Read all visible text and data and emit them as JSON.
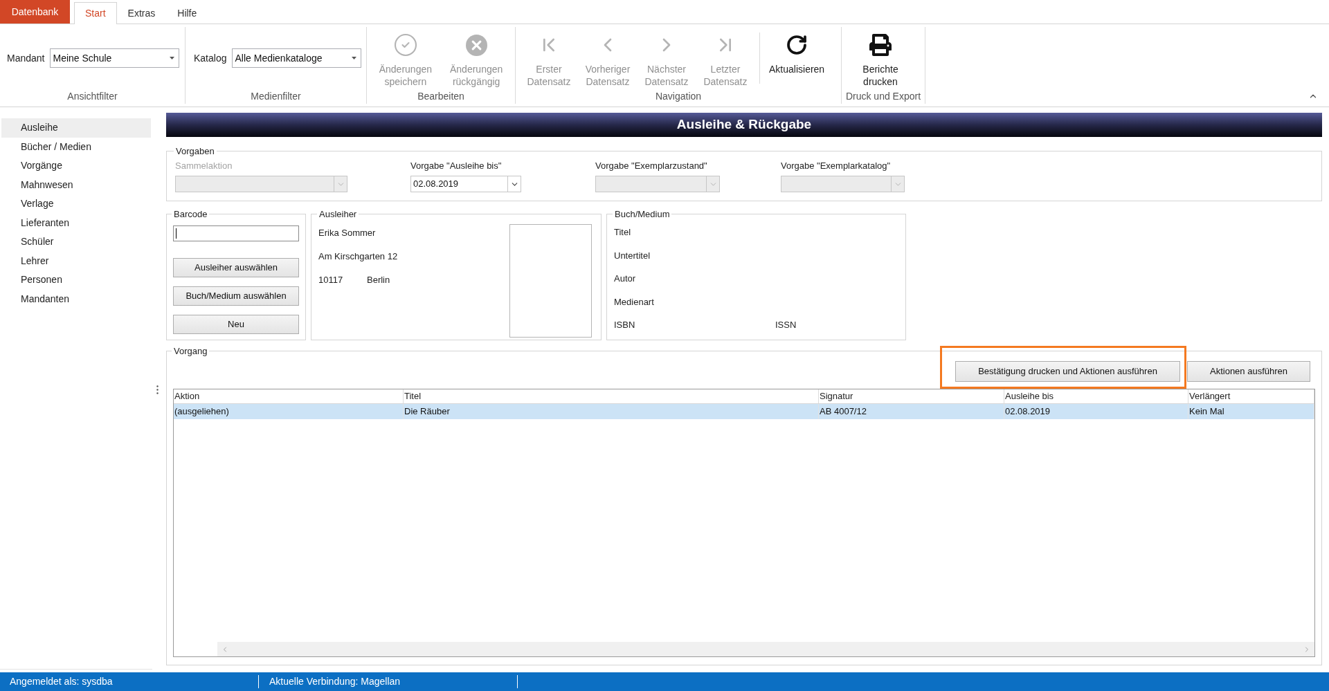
{
  "ribbon_tabs": [
    {
      "label": "Datenbank",
      "kind": "backstage",
      "selected": false
    },
    {
      "label": "Start",
      "kind": "tab",
      "selected": true
    },
    {
      "label": "Extras",
      "kind": "tab",
      "selected": false
    },
    {
      "label": "Hilfe",
      "kind": "tab",
      "selected": false
    }
  ],
  "ribbon_groups": [
    {
      "label": "Ansichtfilter",
      "items": [
        {
          "kind": "combo",
          "label": "Mandant",
          "value": "Meine Schule"
        }
      ]
    },
    {
      "label": "Medienfilter",
      "items": [
        {
          "kind": "combo",
          "label": "Katalog",
          "value": "Alle Medienkataloge"
        }
      ]
    },
    {
      "label": "Bearbeiten",
      "items": [
        {
          "kind": "button",
          "label": "Änderungen speichern",
          "disabled": true
        },
        {
          "kind": "button",
          "label": "Änderungen rückgängig",
          "disabled": true
        }
      ]
    },
    {
      "label": "Navigation",
      "items": [
        {
          "kind": "button",
          "label": "Erster Datensatz",
          "disabled": true
        },
        {
          "kind": "button",
          "label": "Vorheriger Datensatz",
          "disabled": true
        },
        {
          "kind": "button",
          "label": "Nächster Datensatz",
          "disabled": true
        },
        {
          "kind": "button",
          "label": "Letzter Datensatz",
          "disabled": true
        },
        {
          "kind": "separator"
        },
        {
          "kind": "button",
          "label": "Aktualisieren",
          "disabled": false
        }
      ]
    },
    {
      "label": "Druck und Export",
      "items": [
        {
          "kind": "button",
          "label": "Berichte drucken",
          "disabled": false
        }
      ]
    }
  ],
  "sidebar": {
    "items": [
      {
        "label": "Ausleihe",
        "selected": true
      },
      {
        "label": "Bücher / Medien",
        "selected": false
      },
      {
        "label": "Vorgänge",
        "selected": false
      },
      {
        "label": "Mahnwesen",
        "selected": false
      },
      {
        "label": "Verlage",
        "selected": false
      },
      {
        "label": "Lieferanten",
        "selected": false
      },
      {
        "label": "Schüler",
        "selected": false
      },
      {
        "label": "Lehrer",
        "selected": false
      },
      {
        "label": "Personen",
        "selected": false
      },
      {
        "label": "Mandanten",
        "selected": false
      }
    ]
  },
  "panel_title": "Ausleihe & Rückgabe",
  "vorgaben": {
    "legend": "Vorgaben",
    "fields": [
      {
        "label": "Sammelaktion",
        "label_greyed": true,
        "disabled": true
      },
      {
        "label": "Vorgabe \"Ausleihe bis\"",
        "label_greyed": false,
        "disabled": false,
        "value": "02.08.2019"
      },
      {
        "label": "Vorgabe \"Exemplarzustand\"",
        "label_greyed": false,
        "disabled": true
      },
      {
        "label": "Vorgabe \"Exemplarkatalog\"",
        "label_greyed": false,
        "disabled": true
      }
    ]
  },
  "barcode": {
    "legend": "Barcode",
    "input": {
      "focused": true
    },
    "buttons": [
      "Ausleiher auswählen",
      "Buch/Medium auswählen",
      "Neu"
    ]
  },
  "ausleiher": {
    "legend": "Ausleiher",
    "name": "Erika Sommer",
    "street": "Am Kirschgarten 12",
    "zip": "10117",
    "city": "Berlin"
  },
  "buch_medium": {
    "legend": "Buch/Medium",
    "rows": [
      [
        "Titel"
      ],
      [
        "Untertitel"
      ],
      [
        "Autor"
      ],
      [
        "Medienart"
      ],
      [
        "ISBN",
        "ISSN"
      ]
    ]
  },
  "vorgang": {
    "legend": "Vorgang",
    "buttons": [
      {
        "label": "Bestätigung drucken und Aktionen ausführen",
        "highlighted": true
      },
      {
        "label": "Aktionen ausführen",
        "highlighted": false
      }
    ],
    "table": {
      "columns": [
        "Aktion",
        "Titel",
        "Signatur",
        "Ausleihe bis",
        "Verlängert"
      ],
      "rows": [
        {
          "selected": true,
          "cells": [
            "(ausgeliehen)",
            "Die Räuber",
            "AB 4007/12",
            "02.08.2019",
            "Kein Mal"
          ]
        }
      ]
    }
  },
  "status_bar": {
    "items": [
      "Angemeldet als: sysdba",
      "Aktuelle Verbindung: Magellan"
    ]
  }
}
